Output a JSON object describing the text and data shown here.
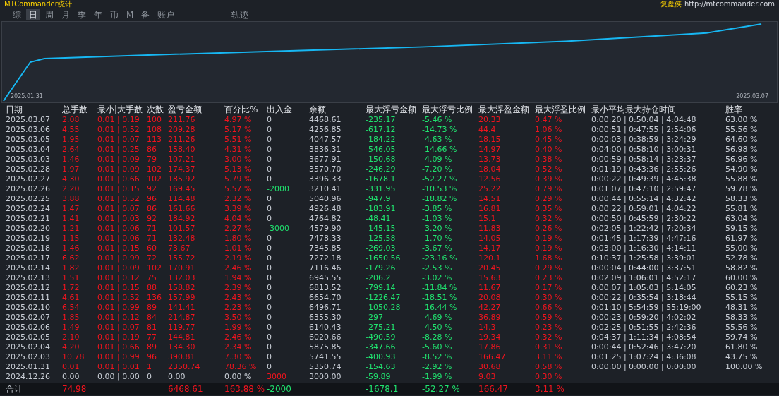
{
  "header": {
    "title": "MTCommander统计",
    "brand": "复盘侠",
    "link": "http://mtcommander.com"
  },
  "tabs": [
    {
      "label": "综",
      "selected": false
    },
    {
      "label": "日",
      "selected": true
    },
    {
      "label": "周",
      "selected": false
    },
    {
      "label": "月",
      "selected": false
    },
    {
      "label": "季",
      "selected": false
    },
    {
      "label": "年",
      "selected": false
    },
    {
      "label": "币",
      "selected": false
    },
    {
      "label": "M",
      "selected": false
    },
    {
      "label": "备",
      "selected": false
    },
    {
      "label": "账户",
      "selected": false
    },
    {
      "label": "轨迹",
      "selected": false
    }
  ],
  "chart": {
    "x_start": "2025.01.31",
    "x_end": "2025.03.07"
  },
  "table": {
    "columns": [
      {
        "label": "日期",
        "kind": "plain"
      },
      {
        "label": "总手数",
        "kind": "profit"
      },
      {
        "label": "最小|大手数",
        "kind": "profit"
      },
      {
        "label": "次数",
        "kind": "profit"
      },
      {
        "label": "盈亏金额",
        "kind": "profit"
      },
      {
        "label": "百分比%",
        "kind": "profit"
      },
      {
        "label": "出入金",
        "kind": "flow"
      },
      {
        "label": "余额",
        "kind": "plain"
      },
      {
        "label": "最大浮亏金额",
        "kind": "loss"
      },
      {
        "label": "最大浮亏比例",
        "kind": "loss"
      },
      {
        "label": "最大浮盈金额",
        "kind": "profit"
      },
      {
        "label": "最大浮盈比例",
        "kind": "profit"
      },
      {
        "label": "最小平均最大持仓时间",
        "kind": "plain"
      },
      {
        "label": "胜率",
        "kind": "plain"
      }
    ],
    "rows": [
      {
        "kind": "day",
        "cells": [
          "2025.03.07",
          "2.08",
          "0.01 | 0.19",
          "100",
          "211.76",
          "4.97 %",
          "0",
          "4468.61",
          "-235.17",
          "-5.46 %",
          "20.33",
          "0.47 %",
          "0:00:20 | 0:50:04 | 4:04:48",
          "63.00 %"
        ]
      },
      {
        "kind": "day",
        "cells": [
          "2025.03.06",
          "4.55",
          "0.01 | 0.52",
          "108",
          "209.28",
          "5.17 %",
          "0",
          "4256.85",
          "-617.12",
          "-14.73 %",
          "44.4",
          "1.06 %",
          "0:00:51 | 0:47:55 | 2:54:06",
          "55.56 %"
        ]
      },
      {
        "kind": "day",
        "cells": [
          "2025.03.05",
          "1.95",
          "0.01 | 0.07",
          "113",
          "211.26",
          "5.51 %",
          "0",
          "4047.57",
          "-184.22",
          "-4.63 %",
          "18.15",
          "0.45 %",
          "0:00:03 | 0:38:59 | 3:24:29",
          "64.60 %"
        ]
      },
      {
        "kind": "day",
        "cells": [
          "2025.03.04",
          "2.64",
          "0.01 | 0.25",
          "86",
          "158.40",
          "4.31 %",
          "0",
          "3836.31",
          "-546.05",
          "-14.66 %",
          "14.97",
          "0.40 %",
          "0:04:00 | 0:58:10 | 3:00:31",
          "56.98 %"
        ]
      },
      {
        "kind": "day",
        "cells": [
          "2025.03.03",
          "1.46",
          "0.01 | 0.09",
          "79",
          "107.21",
          "3.00 %",
          "0",
          "3677.91",
          "-150.68",
          "-4.09 %",
          "13.73",
          "0.38 %",
          "0:00:59 | 0:58:14 | 3:23:37",
          "56.96 %"
        ]
      },
      {
        "kind": "day",
        "cells": [
          "2025.02.28",
          "1.97",
          "0.01 | 0.09",
          "102",
          "174.37",
          "5.13 %",
          "0",
          "3570.70",
          "-246.29",
          "-7.20 %",
          "18.04",
          "0.52 %",
          "0:01:19 | 0:43:36 | 2:55:26",
          "54.90 %"
        ]
      },
      {
        "kind": "day",
        "cells": [
          "2025.02.27",
          "4.30",
          "0.01 | 0.66",
          "102",
          "185.92",
          "5.79 %",
          "0",
          "3396.33",
          "-1678.1",
          "-52.27 %",
          "12.56",
          "0.39 %",
          "0:00:22 | 0:49:39 | 4:45:38",
          "55.88 %"
        ]
      },
      {
        "kind": "withdrawal",
        "cells": [
          "2025.02.26",
          "2.20",
          "0.01 | 0.15",
          "92",
          "169.45",
          "5.57 %",
          "-2000",
          "3210.41",
          "-331.95",
          "-10.53 %",
          "25.22",
          "0.79 %",
          "0:01:07 | 0:47:10 | 2:59:47",
          "59.78 %"
        ]
      },
      {
        "kind": "day",
        "cells": [
          "2025.02.25",
          "3.88",
          "0.01 | 0.52",
          "96",
          "114.48",
          "2.32 %",
          "0",
          "5040.96",
          "-947.9",
          "-18.82 %",
          "14.51",
          "0.29 %",
          "0:00:44 | 0:55:14 | 4:32:42",
          "58.33 %"
        ]
      },
      {
        "kind": "day",
        "cells": [
          "2025.02.24",
          "1.47",
          "0.01 | 0.07",
          "86",
          "161.66",
          "3.39 %",
          "0",
          "4926.48",
          "-183.91",
          "-3.85 %",
          "16.81",
          "0.35 %",
          "0:00:22 | 0:59:01 | 4:04:22",
          "55.81 %"
        ]
      },
      {
        "kind": "day",
        "cells": [
          "2025.02.21",
          "1.41",
          "0.01 | 0.03",
          "92",
          "184.92",
          "4.04 %",
          "0",
          "4764.82",
          "-48.41",
          "-1.03 %",
          "15.1",
          "0.32 %",
          "0:00:50 | 0:45:59 | 2:30:22",
          "63.04 %"
        ]
      },
      {
        "kind": "withdrawal",
        "cells": [
          "2025.02.20",
          "1.21",
          "0.01 | 0.06",
          "71",
          "101.57",
          "2.27 %",
          "-3000",
          "4579.90",
          "-145.15",
          "-3.20 %",
          "11.83",
          "0.26 %",
          "0:02:05 | 1:22:42 | 7:20:34",
          "59.15 %"
        ]
      },
      {
        "kind": "day",
        "cells": [
          "2025.02.19",
          "1.15",
          "0.01 | 0.06",
          "71",
          "132.48",
          "1.80 %",
          "0",
          "7478.33",
          "-125.58",
          "-1.70 %",
          "14.05",
          "0.19 %",
          "0:01:45 | 1:17:39 | 4:47:16",
          "61.97 %"
        ]
      },
      {
        "kind": "day",
        "cells": [
          "2025.02.18",
          "1.46",
          "0.01 | 0.15",
          "60",
          "73.67",
          "1.01 %",
          "0",
          "7345.85",
          "-269.03",
          "-3.67 %",
          "14.17",
          "0.19 %",
          "0:03:00 | 1:16:30 | 4:14:11",
          "55.00 %"
        ]
      },
      {
        "kind": "day",
        "cells": [
          "2025.02.17",
          "6.62",
          "0.01 | 0.99",
          "72",
          "155.72",
          "2.19 %",
          "0",
          "7272.18",
          "-1650.56",
          "-23.16 %",
          "120.1",
          "1.68 %",
          "0:10:37 | 1:25:58 | 3:39:01",
          "52.78 %"
        ]
      },
      {
        "kind": "day",
        "cells": [
          "2025.02.14",
          "1.82",
          "0.01 | 0.09",
          "102",
          "170.91",
          "2.46 %",
          "0",
          "7116.46",
          "-179.26",
          "-2.53 %",
          "20.45",
          "0.29 %",
          "0:00:04 | 0:44:00 | 3:37:51",
          "58.82 %"
        ]
      },
      {
        "kind": "day",
        "cells": [
          "2025.02.13",
          "1.51",
          "0.01 | 0.12",
          "75",
          "132.03",
          "1.94 %",
          "0",
          "6945.55",
          "-206.2",
          "-3.02 %",
          "15.63",
          "0.23 %",
          "0:02:09 | 1:06:01 | 4:52:17",
          "60.00 %"
        ]
      },
      {
        "kind": "day",
        "cells": [
          "2025.02.12",
          "1.72",
          "0.01 | 0.15",
          "88",
          "158.82",
          "2.39 %",
          "0",
          "6813.52",
          "-799.14",
          "-11.84 %",
          "11.67",
          "0.17 %",
          "0:00:07 | 1:05:03 | 5:14:05",
          "60.23 %"
        ]
      },
      {
        "kind": "day",
        "cells": [
          "2025.02.11",
          "4.61",
          "0.01 | 0.52",
          "136",
          "157.99",
          "2.43 %",
          "0",
          "6654.70",
          "-1226.47",
          "-18.51 %",
          "20.08",
          "0.30 %",
          "0:00:22 | 0:35:54 | 3:18:44",
          "55.15 %"
        ]
      },
      {
        "kind": "day",
        "cells": [
          "2025.02.10",
          "6.54",
          "0.01 | 0.99",
          "89",
          "141.41",
          "2.23 %",
          "0",
          "6496.71",
          "-1050.28",
          "-16.44 %",
          "42.27",
          "0.66 %",
          "0:01:10 | 5:54:59 | 55:19:00",
          "48.31 %"
        ]
      },
      {
        "kind": "day",
        "cells": [
          "2025.02.07",
          "1.85",
          "0.01 | 0.12",
          "84",
          "214.87",
          "3.50 %",
          "0",
          "6355.30",
          "-297",
          "-4.69 %",
          "36.89",
          "0.59 %",
          "0:00:23 | 0:59:20 | 4:02:02",
          "58.33 %"
        ]
      },
      {
        "kind": "day",
        "cells": [
          "2025.02.06",
          "1.49",
          "0.01 | 0.07",
          "81",
          "119.77",
          "1.99 %",
          "0",
          "6140.43",
          "-275.21",
          "-4.50 %",
          "14.3",
          "0.23 %",
          "0:02:25 | 0:51:55 | 2:42:36",
          "55.56 %"
        ]
      },
      {
        "kind": "day",
        "cells": [
          "2025.02.05",
          "2.10",
          "0.01 | 0.19",
          "77",
          "144.81",
          "2.46 %",
          "0",
          "6020.66",
          "-490.59",
          "-8.28 %",
          "19.34",
          "0.32 %",
          "0:04:37 | 1:11:34 | 4:08:54",
          "59.74 %"
        ]
      },
      {
        "kind": "day",
        "cells": [
          "2025.02.04",
          "4.20",
          "0.01 | 0.66",
          "89",
          "134.30",
          "2.34 %",
          "0",
          "5875.85",
          "-347.66",
          "-5.60 %",
          "17.86",
          "0.31 %",
          "0:00:44 | 0:52:46 | 3:47:20",
          "61.80 %"
        ]
      },
      {
        "kind": "day",
        "cells": [
          "2025.02.03",
          "10.78",
          "0.01 | 0.99",
          "96",
          "390.81",
          "7.30 %",
          "0",
          "5741.55",
          "-400.93",
          "-8.52 %",
          "166.47",
          "3.11 %",
          "0:01:25 | 1:07:24 | 4:36:08",
          "43.75 %"
        ]
      },
      {
        "kind": "day",
        "cells": [
          "2025.01.31",
          "0.01",
          "0.01 | 0.01",
          "1",
          "2350.74",
          "78.36 %",
          "0",
          "5350.74",
          "-154.63",
          "-2.92 %",
          "30.68",
          "0.58 %",
          "0:00:00 | 0:00:00 | 0:00:00",
          "100.00 %"
        ]
      },
      {
        "kind": "opening",
        "cells": [
          "2024.12.26",
          "0.00",
          "0.00 | 0.00",
          "0",
          "0.00",
          "0.00 %",
          "3000",
          "3000.00",
          "-59.89",
          "-1.99 %",
          "9.03",
          "0.30 %",
          null,
          null
        ]
      }
    ],
    "total": {
      "kind": "total",
      "cells": [
        "合计",
        "74.98",
        null,
        null,
        "6468.61",
        "163.88 %",
        "-2000",
        null,
        "-1678.1",
        "-52.27 %",
        "166.47",
        "3.11 %",
        null,
        null
      ]
    }
  }
}
